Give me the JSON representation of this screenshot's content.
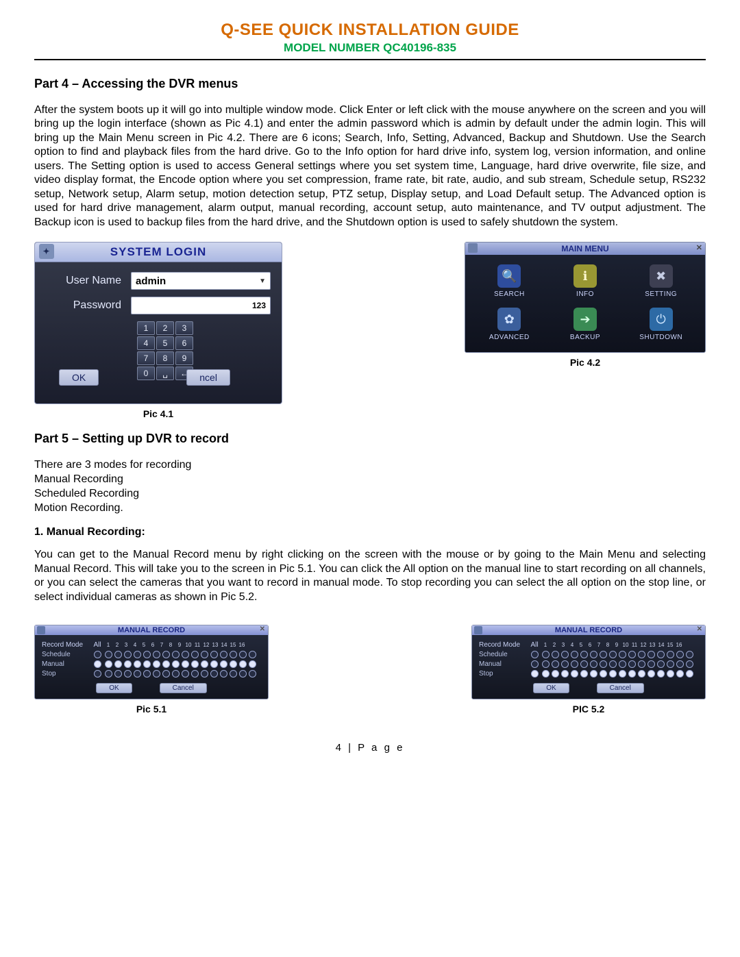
{
  "header": {
    "title": "Q-SEE QUICK INSTALLATION GUIDE",
    "model": "MODEL NUMBER QC40196-835"
  },
  "part4": {
    "heading": "Part 4 – Accessing the DVR menus",
    "body": "After the system boots up it will go into multiple window mode. Click Enter or left click with the mouse anywhere on the screen and you will bring up the login interface (shown as Pic 4.1) and enter the admin password which is admin by default under the admin login. This will bring up the Main Menu screen in Pic 4.2. There are 6 icons; Search, Info, Setting, Advanced, Backup and Shutdown.  Use the Search option to find and playback files from the hard drive. Go to the Info option for hard drive info, system log, version information, and online users.  The Setting  option is used to access General settings where you set system time, Language, hard drive overwrite, file size, and video display format, the Encode option where you set compression, frame rate, bit rate, audio, and sub stream, Schedule setup, RS232 setup, Network setup, Alarm setup, motion detection setup, PTZ setup, Display setup, and Load Default setup.  The Advanced option is used for hard drive management, alarm output, manual recording, account setup, auto maintenance, and TV output adjustment. The Backup icon is used to backup files from the hard drive, and the Shutdown option is used to safely shutdown the system."
  },
  "login": {
    "title": "SYSTEM LOGIN",
    "user_label": "User Name",
    "user_value": "admin",
    "pass_label": "Password",
    "pass_hint": "123",
    "keys": [
      "1",
      "2",
      "3",
      "4",
      "5",
      "6",
      "7",
      "8",
      "9",
      "0",
      "␣",
      "←"
    ],
    "ok": "OK",
    "cancel": "ncel",
    "caption": "Pic 4.1"
  },
  "mainmenu": {
    "title": "MAIN MENU",
    "items": [
      {
        "name": "search-icon",
        "label": "SEARCH",
        "glyph": "🔍"
      },
      {
        "name": "info-icon",
        "label": "INFO",
        "glyph": "ℹ"
      },
      {
        "name": "setting-icon",
        "label": "SETTING",
        "glyph": "✖"
      },
      {
        "name": "advanced-icon",
        "label": "ADVANCED",
        "glyph": "✿"
      },
      {
        "name": "backup-icon",
        "label": "BACKUP",
        "glyph": "➔"
      },
      {
        "name": "shutdown-icon",
        "label": "SHUTDOWN",
        "glyph": "⏻"
      }
    ],
    "caption": "Pic 4.2"
  },
  "part5": {
    "heading": "Part 5 – Setting up DVR to record",
    "modes_intro": "There are 3 modes for recording",
    "modes": [
      "Manual Recording",
      "Scheduled Recording",
      "Motion Recording."
    ],
    "sub_heading": "1. Manual Recording:",
    "body": "You can get to the Manual Record menu by right clicking on the screen with the mouse or by going to the Main Menu and selecting Manual Record. This will take you to the screen in Pic 5.1. You can click the All option on the manual line to start recording on all channels, or you can select the cameras that you want to record in manual mode. To stop recording you can select the all option on the stop line, or select individual cameras as shown in Pic 5.2."
  },
  "manual_record": {
    "title": "MANUAL RECORD",
    "header_label": "Record Mode",
    "all_label": "All",
    "channels": [
      "1",
      "2",
      "3",
      "4",
      "5",
      "6",
      "7",
      "8",
      "9",
      "10",
      "11",
      "12",
      "13",
      "14",
      "15",
      "16"
    ],
    "rows": [
      "Schedule",
      "Manual",
      "Stop"
    ],
    "ok": "OK",
    "cancel": "Cancel",
    "pic51_caption": "Pic 5.1",
    "pic52_caption": "PIC 5.2",
    "pic51_filled_row": 1,
    "pic52_filled_row": 2
  },
  "footer": "4 | P a g e"
}
